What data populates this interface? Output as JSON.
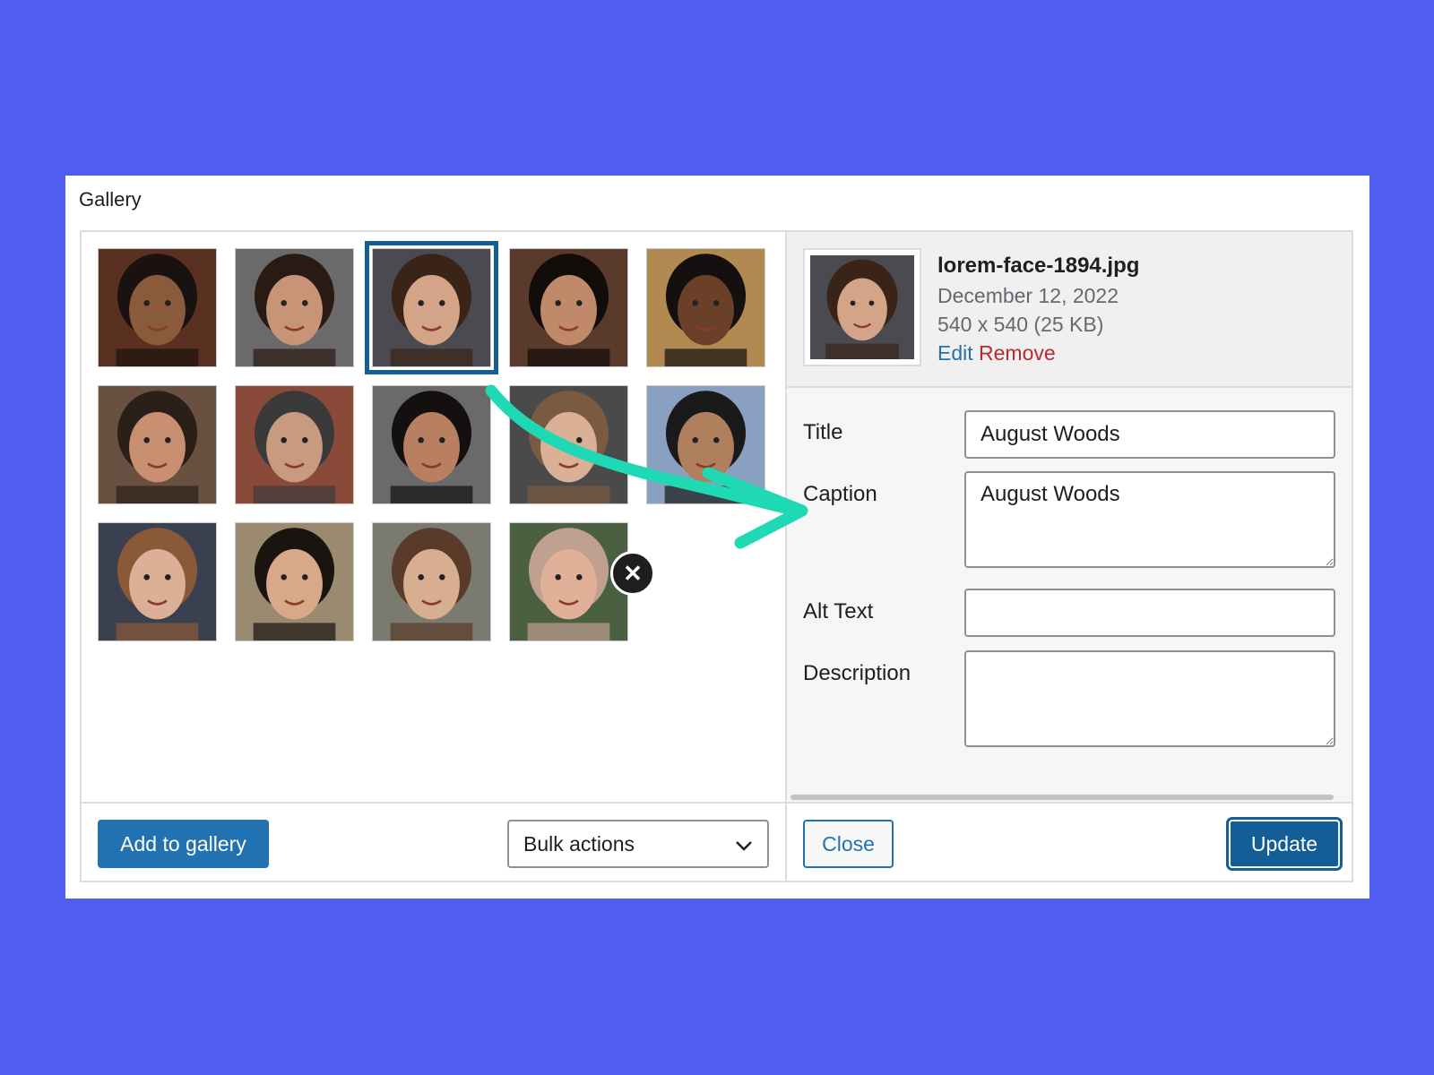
{
  "dialog": {
    "title": "Gallery"
  },
  "gallery": {
    "thumbnails": [
      {
        "skin": "#8a5a3c",
        "hair": "#1a1210",
        "bg": "#5a3020"
      },
      {
        "skin": "#c89478",
        "hair": "#2a1a14",
        "bg": "#6a6a6a"
      },
      {
        "skin": "#d4a488",
        "hair": "#3a2418",
        "bg": "#4a4a50",
        "selected": true
      },
      {
        "skin": "#c08a6a",
        "hair": "#120c0a",
        "bg": "#5a3a2a"
      },
      {
        "skin": "#6a4028",
        "hair": "#141010",
        "bg": "#b08a50"
      },
      {
        "skin": "#c89070",
        "hair": "#2a2018",
        "bg": "#6a5040"
      },
      {
        "skin": "#c89a80",
        "hair": "#3a3a3a",
        "bg": "#8a4a3a"
      },
      {
        "skin": "#b88060",
        "hair": "#141010",
        "bg": "#6a6a6a"
      },
      {
        "skin": "#dab096",
        "hair": "#7a5a40",
        "bg": "#4a4a4a"
      },
      {
        "skin": "#b0805e",
        "hair": "#1a1a1a",
        "bg": "#8aa0c0"
      },
      {
        "skin": "#dcb096",
        "hair": "#8a5a38",
        "bg": "#3a4050"
      },
      {
        "skin": "#d8a888",
        "hair": "#1a1410",
        "bg": "#9a8a70"
      },
      {
        "skin": "#d8ae90",
        "hair": "#5a3a28",
        "bg": "#7a7a70"
      },
      {
        "skin": "#e0b098",
        "hair": "#c0a090",
        "bg": "#4a6040"
      }
    ],
    "remove_icon": "close-icon"
  },
  "details": {
    "filename": "lorem-face-1894.jpg",
    "date": "December 12, 2022",
    "dimensions": "540 x 540 (25 KB)",
    "edit_label": "Edit",
    "remove_label": "Remove"
  },
  "fields": {
    "title_label": "Title",
    "title_value": "August Woods",
    "caption_label": "Caption",
    "caption_value": "August Woods",
    "alt_label": "Alt Text",
    "alt_value": "",
    "description_label": "Description",
    "description_value": ""
  },
  "footer": {
    "add_label": "Add to gallery",
    "bulk_label": "Bulk actions",
    "close_label": "Close",
    "update_label": "Update"
  },
  "colors": {
    "background": "#4f5ef0",
    "primary": "#2271b1",
    "remove": "#b32d2e",
    "arrow": "#1fd8b4"
  }
}
